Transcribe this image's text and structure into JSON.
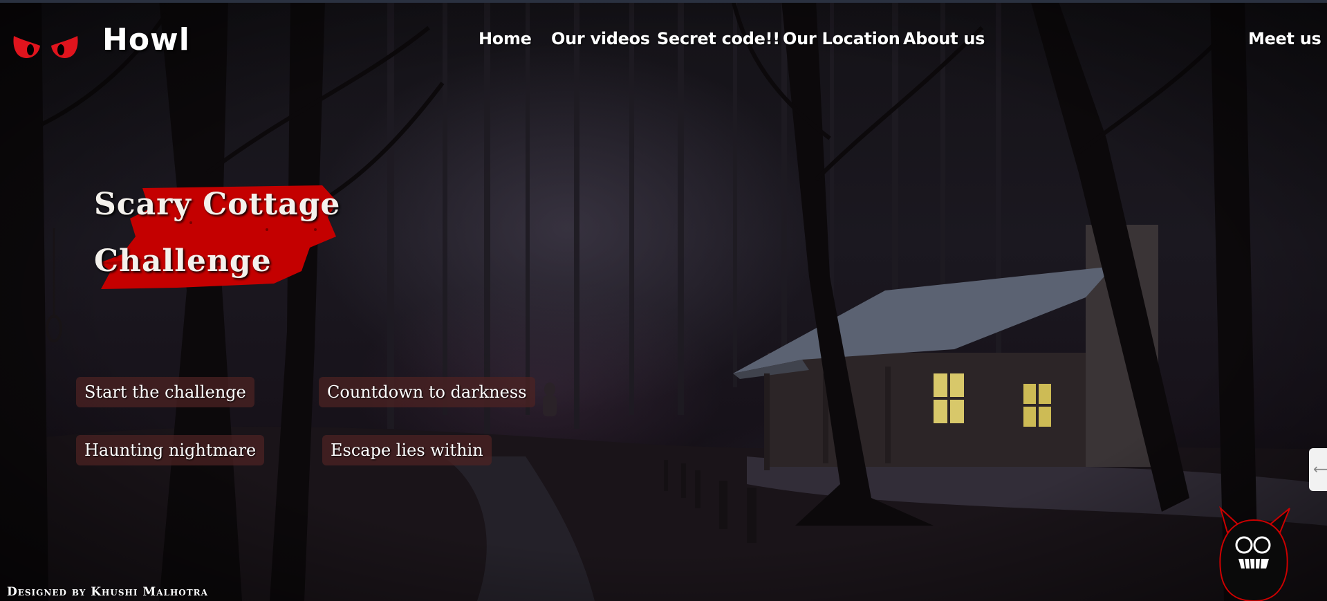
{
  "brand": {
    "logo_icon": "red-eyes-icon",
    "name": "Howl"
  },
  "nav": {
    "items": [
      {
        "label": "Home"
      },
      {
        "label": "Our videos"
      },
      {
        "label": "Secret code!!"
      },
      {
        "label": "Our Location"
      },
      {
        "label": "About us"
      }
    ],
    "meet_label": "Meet us"
  },
  "hero": {
    "title_line1": "Scary Cottage",
    "title_line2": "Challenge",
    "accent_color": "#c40000"
  },
  "actions": [
    {
      "label": "Start the challenge"
    },
    {
      "label": "Countdown to darkness"
    },
    {
      "label": "Haunting nightmare"
    },
    {
      "label": "Escape lies within"
    }
  ],
  "footer": {
    "credit": "Designed by Khushi Malhotra"
  },
  "icons": {
    "mascot": "monster-face-icon",
    "side_tab": "side-tab-icon"
  }
}
